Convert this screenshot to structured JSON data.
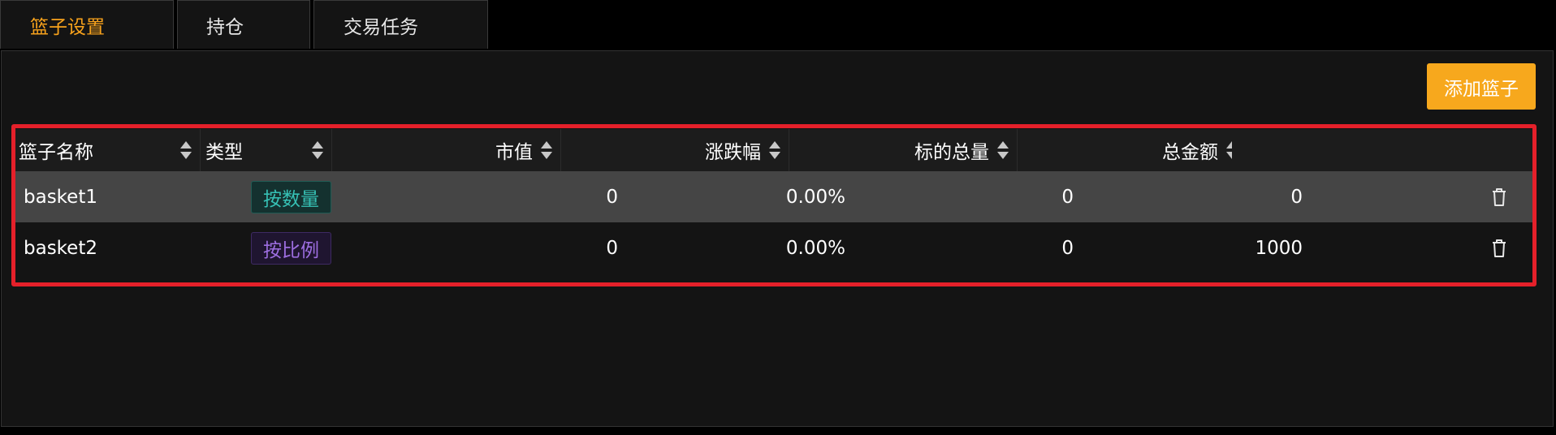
{
  "tabs": [
    {
      "label": "篮子设置",
      "active": true
    },
    {
      "label": "持仓",
      "active": false
    },
    {
      "label": "交易任务",
      "active": false
    }
  ],
  "toolbar": {
    "add_label": "添加篮子"
  },
  "table": {
    "columns": [
      "篮子名称",
      "类型",
      "市值",
      "涨跌幅",
      "标的总量",
      "总金额"
    ],
    "rows": [
      {
        "name": "basket1",
        "type": "按数量",
        "market_value": "0",
        "change": "0.00%",
        "total_qty": "0",
        "total_amount": "0"
      },
      {
        "name": "basket2",
        "type": "按比例",
        "market_value": "0",
        "change": "0.00%",
        "total_qty": "0",
        "total_amount": "1000"
      }
    ]
  },
  "colors": {
    "accent": "#f7a21c",
    "highlight": "#e5202a",
    "tag_qty": "#36c0b4",
    "tag_ratio": "#9d6ee0"
  },
  "icons": {
    "delete": "trash-icon"
  }
}
